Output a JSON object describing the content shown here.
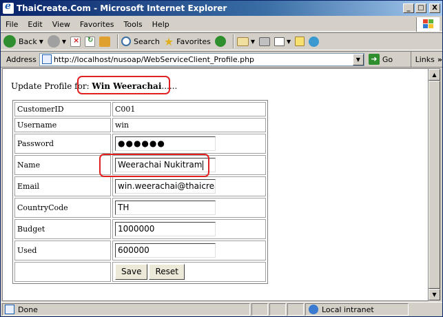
{
  "window": {
    "title": "ThaiCreate.Com - Microsoft Internet Explorer",
    "controls": {
      "minimize": "_",
      "maximize": "□",
      "close": "X"
    }
  },
  "menu": {
    "items": [
      "File",
      "Edit",
      "View",
      "Favorites",
      "Tools",
      "Help"
    ]
  },
  "toolbar": {
    "back_label": "Back",
    "search_label": "Search",
    "favorites_label": "Favorites"
  },
  "address": {
    "label": "Address",
    "url": "http://localhost/nusoap/WebServiceClient_Profile.php",
    "go_label": "Go",
    "links_label": "Links",
    "links_chevron": "»"
  },
  "page": {
    "heading_prefix": "Update Profile for: ",
    "heading_name": "Win Weerachai",
    "heading_suffix": "......",
    "fields": [
      {
        "label": "CustomerID",
        "value": "C001",
        "kind": "text"
      },
      {
        "label": "Username",
        "value": "win",
        "kind": "text"
      },
      {
        "label": "Password",
        "value": "●●●●●●",
        "kind": "password"
      },
      {
        "label": "Name",
        "value": "Weerachai Nukitram",
        "kind": "input"
      },
      {
        "label": "Email",
        "value": "win.weerachai@thaicrea",
        "kind": "input"
      },
      {
        "label": "CountryCode",
        "value": "TH",
        "kind": "input"
      },
      {
        "label": "Budget",
        "value": "1000000",
        "kind": "input"
      },
      {
        "label": "Used",
        "value": "600000",
        "kind": "input"
      }
    ],
    "save_label": "Save",
    "reset_label": "Reset"
  },
  "status": {
    "text": "Done",
    "zone": "Local intranet"
  },
  "colors": {
    "highlight": "#e02020",
    "titlebar": "#0a246a"
  }
}
